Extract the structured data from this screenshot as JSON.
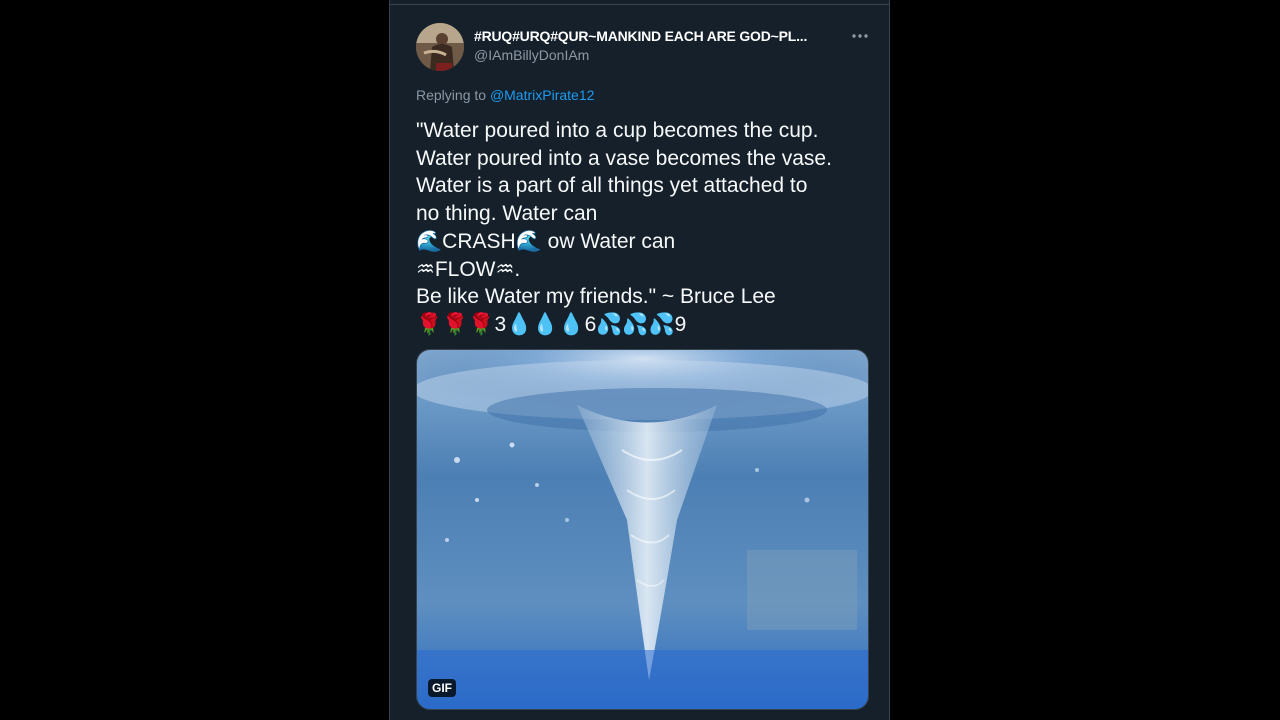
{
  "tweet": {
    "author": {
      "display_name": "#RUQ#URQ#QUR~MANKIND EACH ARE GOD~PL...",
      "handle": "@IAmBillyDonIAm"
    },
    "reply": {
      "prefix": "Replying to",
      "mention": "@MatrixPirate12"
    },
    "text_lines": [
      "\"Water poured into a cup becomes the cup.",
      "Water poured into a vase becomes the vase.",
      "Water is a part of all things yet attached to",
      "no thing. Water can",
      "🌊CRASH🌊 ow Water can",
      "♒FLOW♒.",
      "Be like Water my friends.\" ~ Bruce Lee",
      "🌹🌹🌹3💧💧💧6💦💦💦9"
    ],
    "media": {
      "badge": "GIF",
      "subject": "water-vortex"
    }
  },
  "icons": {
    "more": "more-options-icon",
    "avatar": "user-avatar"
  },
  "colors": {
    "background": "#15202b",
    "page": "#000000",
    "text": "#f7f9f9",
    "secondary": "#8b98a5",
    "link": "#1d9bf0",
    "border": "#38444d"
  }
}
